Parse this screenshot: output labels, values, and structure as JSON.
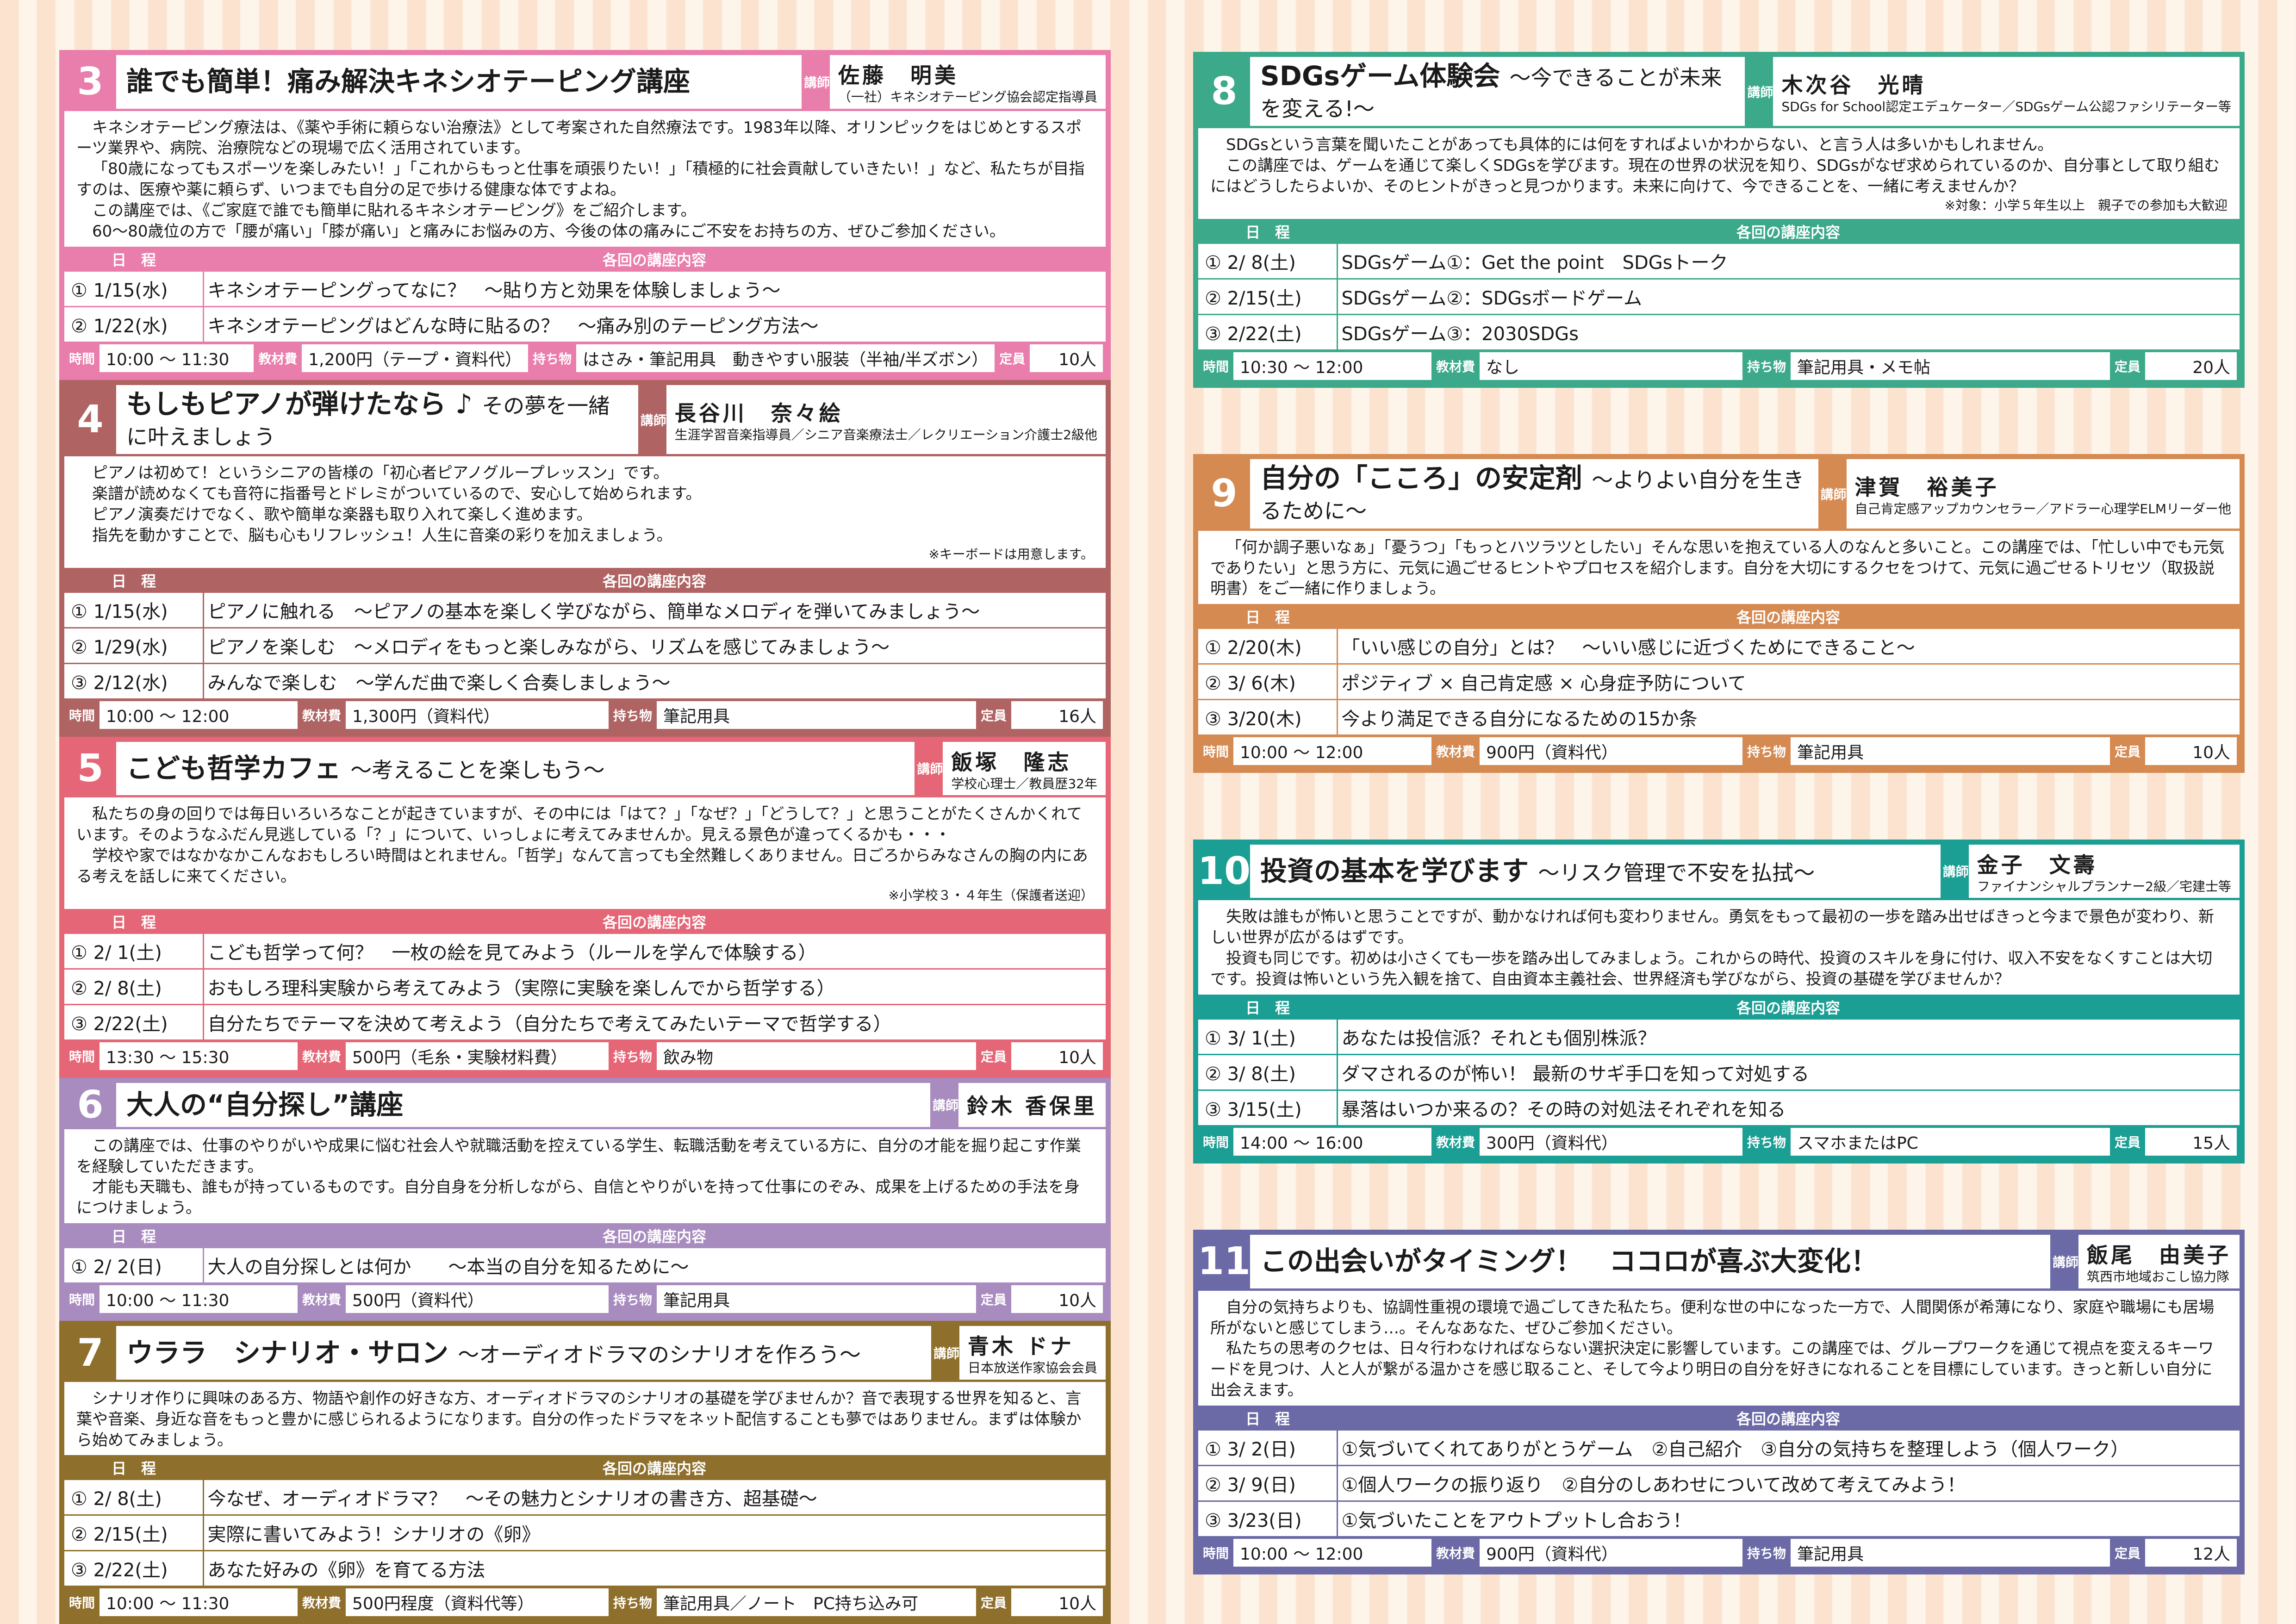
{
  "labels": {
    "lecturer": "講師",
    "schedule_header": "日　程",
    "content_header": "各回の講座内容",
    "time": "時間",
    "fee": "教材費",
    "bring": "持ち物",
    "capacity": "定員"
  },
  "colors": {
    "c3": "#e97dab",
    "c4": "#b06363",
    "c5": "#e56676",
    "c6": "#a88bbf",
    "c7": "#8f6f2c",
    "c8": "#3ba98a",
    "c9": "#d58a52",
    "c10": "#1b9e93",
    "c11": "#6b6aa6"
  },
  "courses": [
    {
      "num": "3",
      "title": "誰でも簡単！痛み解決キネシオテーピング講座",
      "subtitle": "",
      "lecturer": "佐藤　明美",
      "role": "（一社）キネシオテーピング協会認定指導員",
      "desc": [
        "キネシオテーピング療法は、《薬や手術に頼らない治療法》として考案された自然療法です。1983年以降、オリンピックをはじめとするスポーツ業界や、病院、治療院などの現場で広く活用されています。",
        "「80歳になってもスポーツを楽しみたい！」「これからもっと仕事を頑張りたい！」「積極的に社会貢献していきたい！」など、私たちが目指すのは、医療や薬に頼らず、いつまでも自分の足で歩ける健康な体ですよね。",
        "この講座では、《ご家庭で誰でも簡単に貼れるキネシオテーピング》をご紹介します。",
        "60〜80歳位の方で「腰が痛い」「膝が痛い」と痛みにお悩みの方、今後の体の痛みにご不安をお持ちの方、ぜひご参加ください。"
      ],
      "note": "",
      "sessions": [
        {
          "date": "① 1/15(水)",
          "content": "キネシオテーピングってなに？　〜貼り方と効果を体験しましょう〜"
        },
        {
          "date": "② 1/22(水)",
          "content": "キネシオテーピングはどんな時に貼るの？　〜痛み別のテーピング方法〜"
        }
      ],
      "time": "10:00 〜 11:30",
      "fee": "1,200円（テープ・資料代）",
      "bring": "はさみ・筆記用具　動きやすい服装（半袖/半ズボン）",
      "capacity": "10人"
    },
    {
      "num": "4",
      "title": "もしもピアノが弾けたなら ♪",
      "subtitle": "その夢を一緒に叶えましょう",
      "lecturer": "長谷川　奈々絵",
      "role": "生涯学習音楽指導員／シニア音楽療法士／レクリエーション介護士2級他",
      "desc": [
        "ピアノは初めて！というシニアの皆様の「初心者ピアノグループレッスン」です。",
        "楽譜が読めなくても音符に指番号とドレミがついているので、安心して始められます。",
        "ピアノ演奏だけでなく、歌や簡単な楽器も取り入れて楽しく進めます。",
        "指先を動かすことで、脳も心もリフレッシュ！人生に音楽の彩りを加えましょう。"
      ],
      "note": "※キーボードは用意します。",
      "sessions": [
        {
          "date": "① 1/15(水)",
          "content": "ピアノに触れる　〜ピアノの基本を楽しく学びながら、簡単なメロディを弾いてみましょう〜"
        },
        {
          "date": "② 1/29(水)",
          "content": "ピアノを楽しむ　〜メロディをもっと楽しみながら、リズムを感じてみましょう〜"
        },
        {
          "date": "③ 2/12(水)",
          "content": "みんなで楽しむ　〜学んだ曲で楽しく合奏しましょう〜"
        }
      ],
      "time": "10:00 〜 12:00",
      "fee": "1,300円（資料代）",
      "bring": "筆記用具",
      "capacity": "16人"
    },
    {
      "num": "5",
      "title": "こども哲学カフェ",
      "subtitle": "〜考えることを楽しもう〜",
      "lecturer": "飯塚　隆志",
      "role": "学校心理士／教員歴32年",
      "desc": [
        "私たちの身の回りでは毎日いろいろなことが起きていますが、その中には「はて？」「なぜ？」「どうして？」と思うことがたくさんかくれています。そのようなふだん見逃している「？」について、いっしょに考えてみませんか。見える景色が違ってくるかも・・・",
        "学校や家ではなかなかこんなおもしろい時間はとれません。「哲学」なんて言っても全然難しくありません。日ごろからみなさんの胸の内にある考えを話しに来てください。"
      ],
      "note": "※小学校３・４年生（保護者送迎）",
      "sessions": [
        {
          "date": "① 2/ 1(土)",
          "content": "こども哲学って何？　一枚の絵を見てみよう（ルールを学んで体験する）"
        },
        {
          "date": "② 2/ 8(土)",
          "content": "おもしろ理科実験から考えてみよう（実際に実験を楽しんでから哲学する）"
        },
        {
          "date": "③ 2/22(土)",
          "content": "自分たちでテーマを決めて考えよう（自分たちで考えてみたいテーマで哲学する）"
        }
      ],
      "time": "13:30 〜 15:30",
      "fee": "500円（毛糸・実験材料費）",
      "bring": "飲み物",
      "capacity": "10人"
    },
    {
      "num": "6",
      "title": "大人の“自分探し”講座",
      "subtitle": "",
      "lecturer": "鈴木 香保里",
      "role": "",
      "desc": [
        "この講座では、仕事のやりがいや成果に悩む社会人や就職活動を控えている学生、転職活動を考えている方に、自分の才能を掘り起こす作業を経験していただきます。",
        "才能も天職も、誰もが持っているものです。自分自身を分析しながら、自信とやりがいを持って仕事にのぞみ、成果を上げるための手法を身につけましょう。"
      ],
      "note": "",
      "sessions": [
        {
          "date": "① 2/ 2(日)",
          "content": "大人の自分探しとは何か　　〜本当の自分を知るために〜"
        }
      ],
      "time": "10:00 〜 11:30",
      "fee": "500円（資料代）",
      "bring": "筆記用具",
      "capacity": "10人"
    },
    {
      "num": "7",
      "title": "ウララ　シナリオ・サロン",
      "subtitle": "〜オーディオドラマのシナリオを作ろう〜",
      "lecturer": "青木 ドナ",
      "role": "日本放送作家協会会員",
      "desc": [
        "シナリオ作りに興味のある方、物語や創作の好きな方、オーディオドラマのシナリオの基礎を学びませんか？音で表現する世界を知ると、言葉や音楽、身近な音をもっと豊かに感じられるようになります。自分の作ったドラマをネット配信することも夢ではありません。まずは体験から始めてみましょう。"
      ],
      "note": "",
      "sessions": [
        {
          "date": "① 2/ 8(土)",
          "content": "今なぜ、オーディオドラマ？　〜その魅力とシナリオの書き方、超基礎〜"
        },
        {
          "date": "② 2/15(土)",
          "content": "実際に書いてみよう！シナリオの《卵》"
        },
        {
          "date": "③ 2/22(土)",
          "content": "あなた好みの《卵》を育てる方法"
        }
      ],
      "time": "10:00 〜 11:30",
      "fee": "500円程度（資料代等）",
      "bring": "筆記用具／ノート　PC持ち込み可",
      "capacity": "10人"
    },
    {
      "num": "8",
      "title": "SDGsゲーム体験会",
      "subtitle": "〜今できることが未来を変える!〜",
      "lecturer": "木次谷　光晴",
      "role": "SDGs for School認定エデュケーター／SDGsゲーム公認ファシリテーター等",
      "desc": [
        "SDGsという言葉を聞いたことがあっても具体的には何をすればよいかわからない、と言う人は多いかもしれません。",
        "この講座では、ゲームを通じて楽しくSDGsを学びます。現在の世界の状況を知り、SDGsがなぜ求められているのか、自分事として取り組むにはどうしたらよいか、そのヒントがきっと見つかります。未来に向けて、今できることを、一緒に考えませんか？"
      ],
      "note": "※対象：小学５年生以上　親子での参加も大歓迎",
      "sessions": [
        {
          "date": "① 2/ 8(土)",
          "content": "SDGsゲーム①：Get the point　SDGsトーク"
        },
        {
          "date": "② 2/15(土)",
          "content": "SDGsゲーム②：SDGsボードゲーム"
        },
        {
          "date": "③ 2/22(土)",
          "content": "SDGsゲーム③：2030SDGs"
        }
      ],
      "time": "10:30 〜 12:00",
      "fee": "なし",
      "bring": "筆記用具・メモ帖",
      "capacity": "20人"
    },
    {
      "num": "9",
      "title": "自分の「こころ」の安定剤",
      "subtitle": "〜よりよい自分を生きるために〜",
      "lecturer": "津賀　裕美子",
      "role": "自己肯定感アップカウンセラー／アドラー心理学ELMリーダー他",
      "desc": [
        "「何か調子悪いなぁ」「憂うつ」「もっとハツラツとしたい」そんな思いを抱えている人のなんと多いこと。この講座では、「忙しい中でも元気でありたい」と思う方に、元気に過ごせるヒントやプロセスを紹介します。自分を大切にするクセをつけて、元気に過ごせるトリセツ（取扱説明書）をご一緒に作りましょう。"
      ],
      "note": "",
      "sessions": [
        {
          "date": "① 2/20(木)",
          "content": "「いい感じの自分」とは？　〜いい感じに近づくためにできること〜"
        },
        {
          "date": "② 3/ 6(木)",
          "content": "ポジティブ × 自己肯定感 × 心身症予防について"
        },
        {
          "date": "③ 3/20(木)",
          "content": "今より満足できる自分になるための15か条"
        }
      ],
      "time": "10:00 〜 12:00",
      "fee": "900円（資料代）",
      "bring": "筆記用具",
      "capacity": "10人"
    },
    {
      "num": "10",
      "title": "投資の基本を学びます",
      "subtitle": "〜リスク管理で不安を払拭〜",
      "lecturer": "金子　文壽",
      "role": "ファイナンシャルプランナー2級／宅建士等",
      "desc": [
        "失敗は誰もが怖いと思うことですが、動かなければ何も変わりません。勇気をもって最初の一歩を踏み出せばきっと今まで景色が変わり、新しい世界が広がるはずです。",
        "投資も同じです。初めは小さくても一歩を踏み出してみましょう。これからの時代、投資のスキルを身に付け、収入不安をなくすことは大切です。投資は怖いという先入観を捨て、自由資本主義社会、世界経済も学びながら、投資の基礎を学びませんか？"
      ],
      "note": "",
      "sessions": [
        {
          "date": "① 3/ 1(土)",
          "content": "あなたは投信派？それとも個別株派？"
        },
        {
          "date": "② 3/ 8(土)",
          "content": "ダマされるのが怖い！ 最新のサギ手口を知って対処する"
        },
        {
          "date": "③ 3/15(土)",
          "content": "暴落はいつか来るの？その時の対処法それぞれを知る"
        }
      ],
      "time": "14:00 〜 16:00",
      "fee": "300円（資料代）",
      "bring": "スマホまたはPC",
      "capacity": "15人"
    },
    {
      "num": "11",
      "title": "この出会いがタイミング！　ココロが喜ぶ大変化！",
      "subtitle": "",
      "lecturer": "飯尾　由美子",
      "role": "筑西市地域おこし協力隊",
      "desc": [
        "自分の気持ちよりも、協調性重視の環境で過ごしてきた私たち。便利な世の中になった一方で、人間関係が希薄になり、家庭や職場にも居場所がないと感じてしまう…。そんなあなた、ぜひご参加ください。",
        "私たちの思考のクセは、日々行わなければならない選択決定に影響しています。この講座では、グループワークを通じて視点を変えるキーワードを見つけ、人と人が繋がる温かさを感じ取ること、そして今より明日の自分を好きになれることを目標にしています。きっと新しい自分に出会えます。"
      ],
      "note": "",
      "sessions": [
        {
          "date": "① 3/ 2(日)",
          "content": "①気づいてくれてありがとうゲーム　②自己紹介　③自分の気持ちを整理しよう（個人ワーク）"
        },
        {
          "date": "② 3/ 9(日)",
          "content": "①個人ワークの振り返り　②自分のしあわせについて改めて考えてみよう！"
        },
        {
          "date": "③ 3/23(日)",
          "content": "①気づいたことをアウトプットし合おう！"
        }
      ],
      "time": "10:00 〜 12:00",
      "fee": "900円（資料代）",
      "bring": "筆記用具",
      "capacity": "12人"
    }
  ]
}
